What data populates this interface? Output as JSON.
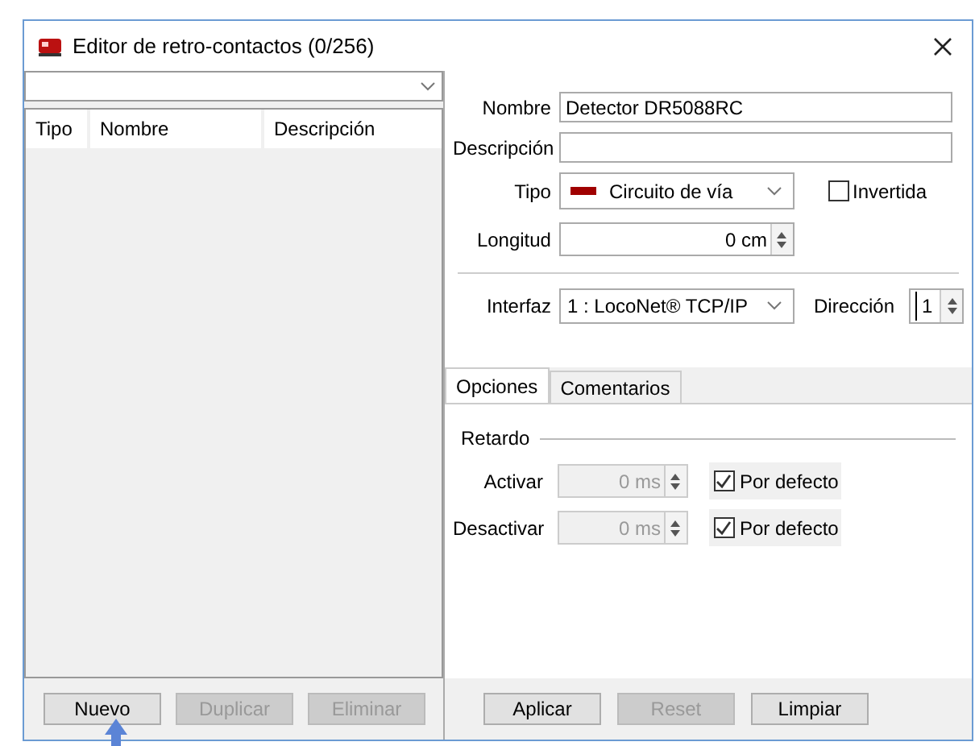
{
  "window": {
    "title": "Editor de retro-contactos (0/256)"
  },
  "list": {
    "columns": [
      "Tipo",
      "Nombre",
      "Descripción"
    ],
    "buttons": [
      {
        "label": "Nuevo",
        "disabled": false
      },
      {
        "label": "Duplicar",
        "disabled": true
      },
      {
        "label": "Eliminar",
        "disabled": true
      }
    ]
  },
  "form": {
    "nombre": {
      "label": "Nombre",
      "value": "Detector DR5088RC"
    },
    "descripcion": {
      "label": "Descripción"
    },
    "tipo": {
      "label": "Tipo",
      "value": "Circuito de vía",
      "color": "#a00000"
    },
    "invertida": {
      "label": "Invertida",
      "checked": false
    },
    "longitud": {
      "label": "Longitud",
      "value": "0 cm"
    },
    "interfaz": {
      "label": "Interfaz",
      "value": "1 : LocoNet® TCP/IP"
    },
    "direccion": {
      "label": "Dirección",
      "value": "1"
    }
  },
  "tabs": [
    {
      "label": "Opciones",
      "selected": true
    },
    {
      "label": "Comentarios",
      "selected": false
    }
  ],
  "retardo": {
    "title": "Retardo",
    "rows": [
      {
        "label": "Activar",
        "value": "0 ms",
        "disabled": true,
        "default_label": "Por defecto",
        "checked": true
      },
      {
        "label": "Desactivar",
        "value": "0 ms",
        "disabled": true,
        "default_label": "Por defecto",
        "checked": true
      }
    ]
  },
  "buttons": [
    {
      "label": "Aplicar",
      "disabled": false
    },
    {
      "label": "Reset",
      "disabled": true
    },
    {
      "label": "Limpiar",
      "disabled": false
    }
  ],
  "pointer": {
    "kind": "arrow"
  }
}
